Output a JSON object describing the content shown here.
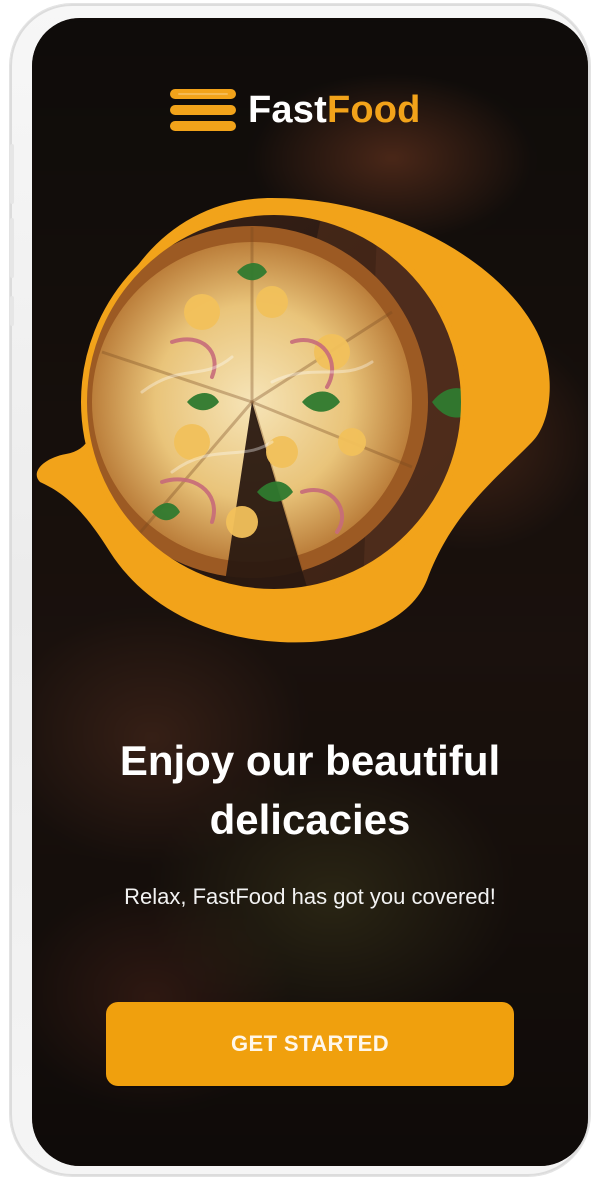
{
  "brand": {
    "name_part_1": "Fast",
    "name_part_2": "Food",
    "primary_color": "#f2a31a",
    "text_color": "#ffffff",
    "icon": "burger-logo-icon"
  },
  "hero": {
    "image": "pizza-hero-image",
    "accent_color": "#f2a31a"
  },
  "content": {
    "headline": "Enjoy our beautiful delicacies",
    "subtitle": "Relax, FastFood has got you covered!"
  },
  "actions": {
    "get_started_label": "GET STARTED"
  }
}
